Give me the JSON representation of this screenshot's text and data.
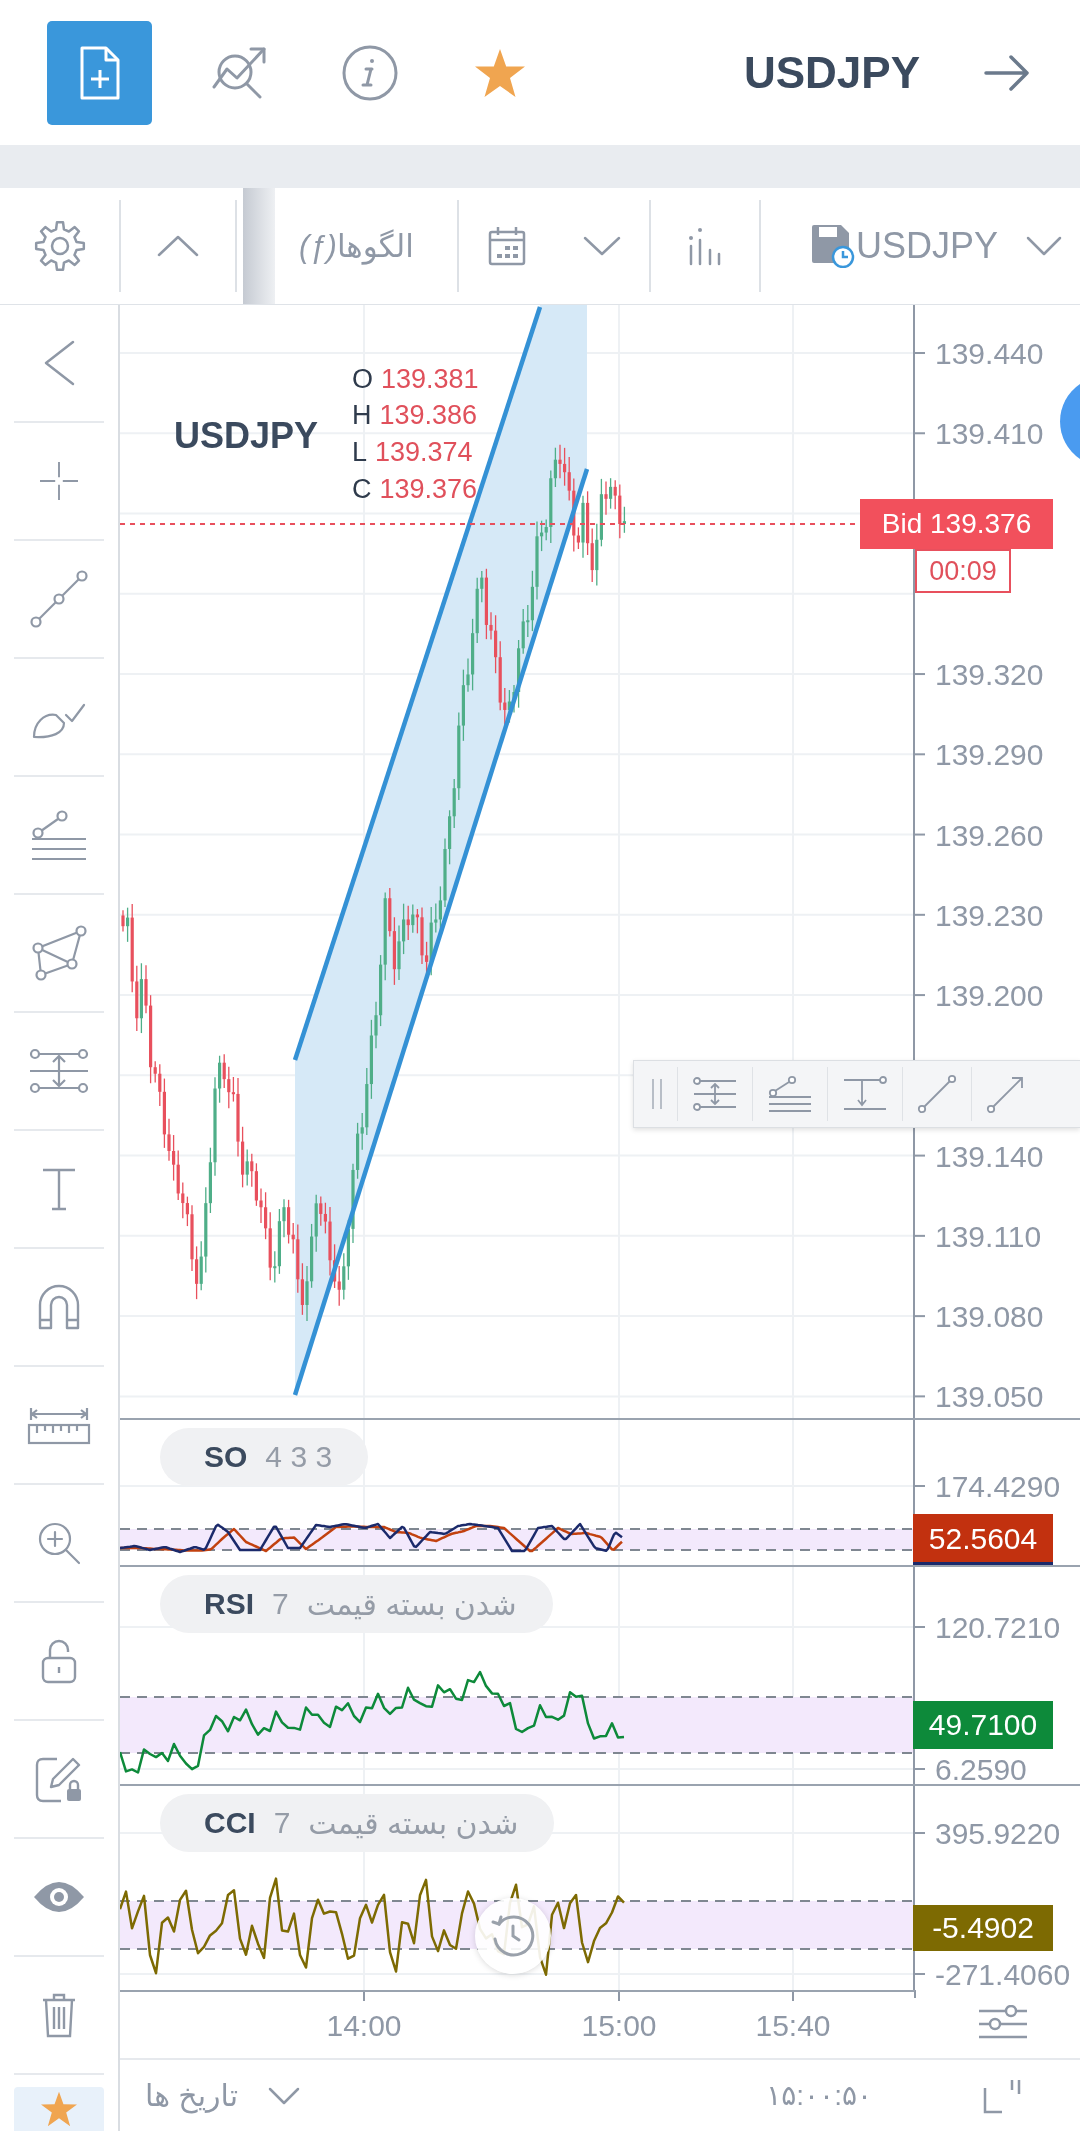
{
  "header": {
    "symbol": "USDJPY"
  },
  "toolbar": {
    "function_symbol": "(ƒ)",
    "patterns_label": "الگوها",
    "symbol": "USDJPY"
  },
  "left_toolbar": {
    "favorites_selected": true
  },
  "chart": {
    "symbol": "USDJPY",
    "ohlc": [
      {
        "label": "O",
        "value": "139.381"
      },
      {
        "label": "H",
        "value": "139.386"
      },
      {
        "label": "L",
        "value": "139.374"
      },
      {
        "label": "C",
        "value": "139.376"
      }
    ],
    "price_ticks": [
      "139.440",
      "139.410",
      "139.320",
      "139.290",
      "139.260",
      "139.230",
      "139.200",
      "139.140",
      "139.110",
      "139.080",
      "139.050"
    ],
    "bid_label": "Bid 139.376",
    "countdown": "00:09"
  },
  "indicators": [
    {
      "kind": "stochastic",
      "name": "SO",
      "params": "4 3 3",
      "ticks": [
        "174.4290"
      ],
      "value": "52.5604",
      "color": "#c2310f"
    },
    {
      "kind": "rsi",
      "name": "RSI",
      "period": "7",
      "source": "شدن بسته قیمت",
      "ticks": [
        "120.7210",
        "6.2590"
      ],
      "value": "49.7100",
      "color": "#0d8a3a"
    },
    {
      "kind": "cci",
      "name": "CCI",
      "period": "7",
      "source": "شدن بسته قیمت",
      "ticks": [
        "395.9220",
        "-271.4060"
      ],
      "value": "-5.4902",
      "color": "#7d6a02"
    }
  ],
  "time_axis": {
    "ticks": [
      "14:00",
      "15:00",
      "15:40"
    ]
  },
  "bottom_bar": {
    "range_label": "تاریخ ها",
    "clock": "۱۵:۰۰:۵۰"
  }
}
